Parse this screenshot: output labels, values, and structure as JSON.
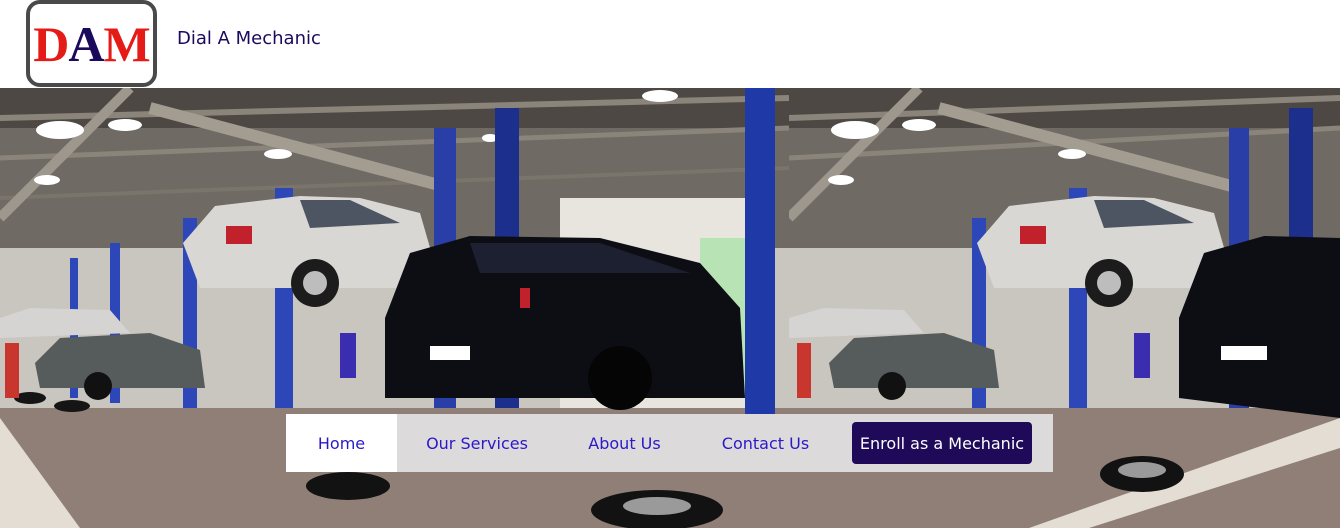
{
  "header": {
    "logo": {
      "letters": [
        "D",
        "A",
        "M"
      ]
    },
    "brand_name": "Dial A Mechanic"
  },
  "hero": {
    "image": "car-repair-garage-photo"
  },
  "nav": {
    "items": [
      {
        "label": "Home",
        "active": true
      },
      {
        "label": "Our Services",
        "active": false
      },
      {
        "label": "About Us",
        "active": false
      },
      {
        "label": "Contact Us",
        "active": false
      }
    ],
    "cta_label": "Enroll as a Mechanic"
  },
  "colors": {
    "brand_navy": "#1b0a5c",
    "logo_red": "#e41b17",
    "nav_link": "#2a19c9",
    "nav_bg": "#dcdadb",
    "cta_bg": "#1f0a5a"
  }
}
